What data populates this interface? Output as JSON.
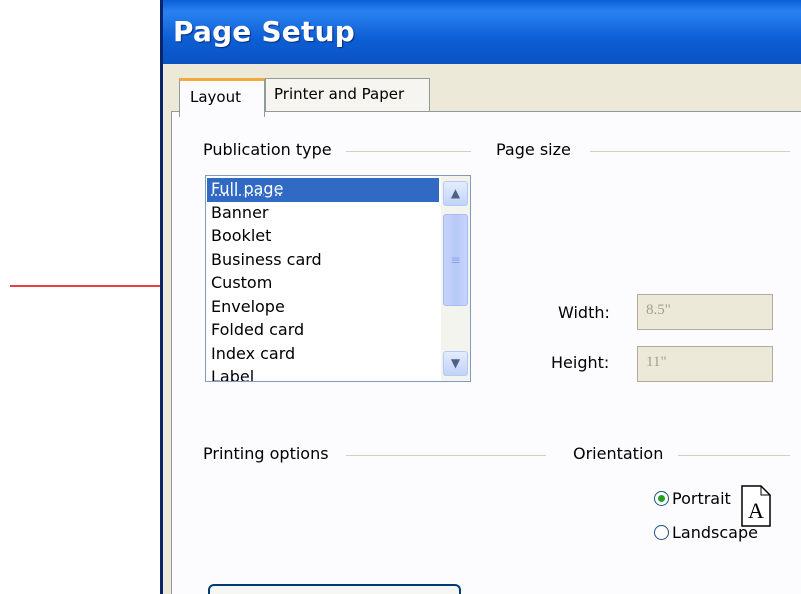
{
  "window": {
    "title": "Page Setup"
  },
  "tabs": [
    {
      "label": "Layout",
      "active": true
    },
    {
      "label": "Printer and Paper",
      "active": false
    }
  ],
  "publication_type": {
    "label": "Publication type",
    "items": [
      "Full page",
      "Banner",
      "Booklet",
      "Business card",
      "Custom",
      "Envelope",
      "Folded card",
      "Index card",
      "Label"
    ],
    "selected": "Full page"
  },
  "page_size": {
    "label": "Page size",
    "width_label": "Width:",
    "width_value": "8.5\"",
    "height_label": "Height:",
    "height_value": "11\""
  },
  "printing_options": {
    "label": "Printing options"
  },
  "orientation": {
    "label": "Orientation",
    "icon_letter": "A",
    "options": [
      {
        "label": "Portrait",
        "checked": true
      },
      {
        "label": "Landscape",
        "checked": false
      }
    ]
  },
  "colors": {
    "title_bar": "#0a5fd8",
    "selection": "#316ac5",
    "arrow": "#e00000",
    "tab_accent": "#f3a93b"
  }
}
